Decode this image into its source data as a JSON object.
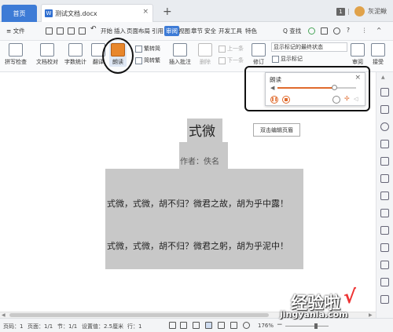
{
  "tabbar": {
    "home_tab": "首页",
    "doc_tab": "测试文档.docx",
    "doc_badge": "W",
    "close": "×",
    "add": "+",
    "window_count": "1",
    "username": "灰泥鳅"
  },
  "menubar": {
    "file": "≡ 文件",
    "items": [
      "开始",
      "插入",
      "页面布局",
      "引用",
      "审阅",
      "视图",
      "章节",
      "安全",
      "开发工具",
      "特色"
    ],
    "active": "审阅",
    "search": "Q 查找",
    "right_icons": [
      "?",
      "⋮",
      "^"
    ]
  },
  "ribbon": {
    "spell": "拼写检查",
    "proof": "文档校对",
    "wordcount": "字数统计",
    "translate": "翻译",
    "read": "朗读",
    "trad": "繁转简",
    "simp": "简转繁",
    "comment": "插入批注",
    "delete": "删除",
    "prev": "上一条",
    "next": "下一条",
    "revise": "修订",
    "markup_state": "显示标记的最终状态",
    "show_markup": "显示标记",
    "accept": "接受",
    "read_mode": "审阅"
  },
  "read_panel": {
    "title": "朗读",
    "volume_level": 0.72
  },
  "document": {
    "title": "式微",
    "author": "作者：佚名",
    "line1": "式微，式微，胡不归？微君之故，胡为乎中露！",
    "line2": "式微，式微，胡不归？微君之躬，胡为乎泥中！",
    "hint": "双击编辑页眉"
  },
  "statusbar": {
    "page": "页码：1",
    "pages": "页面：1/1",
    "section": "节：1/1",
    "setting": "设置值：2.5厘米",
    "row": "行：1",
    "zoom": "176%",
    "minus": "−",
    "plus": "+"
  },
  "watermark": {
    "cn": "经验啦",
    "check": "√",
    "url": "jingyanla.com"
  },
  "colors": {
    "accent": "#3d7bd6",
    "highlight": "#c8c8c8",
    "play": "#e06a2c"
  }
}
